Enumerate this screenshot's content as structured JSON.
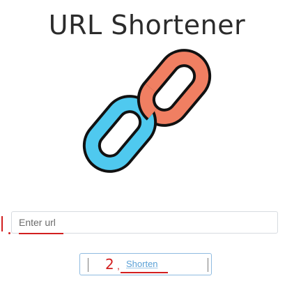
{
  "header": {
    "title": "URL Shortener"
  },
  "logo": {
    "icon": "chain-link-icon",
    "colors": {
      "upper_link": "#f07f62",
      "lower_link": "#4fc9ef",
      "outline": "#111111"
    }
  },
  "form": {
    "url_input": {
      "placeholder": "Enter url",
      "value": ""
    },
    "shorten_button": {
      "label": "Shorten",
      "annotation_number": "2",
      "annotation_comma": ","
    }
  },
  "colors": {
    "annotation_red": "#d21f1f",
    "button_border": "#8fbbe0",
    "button_text": "#5aa0d6"
  }
}
